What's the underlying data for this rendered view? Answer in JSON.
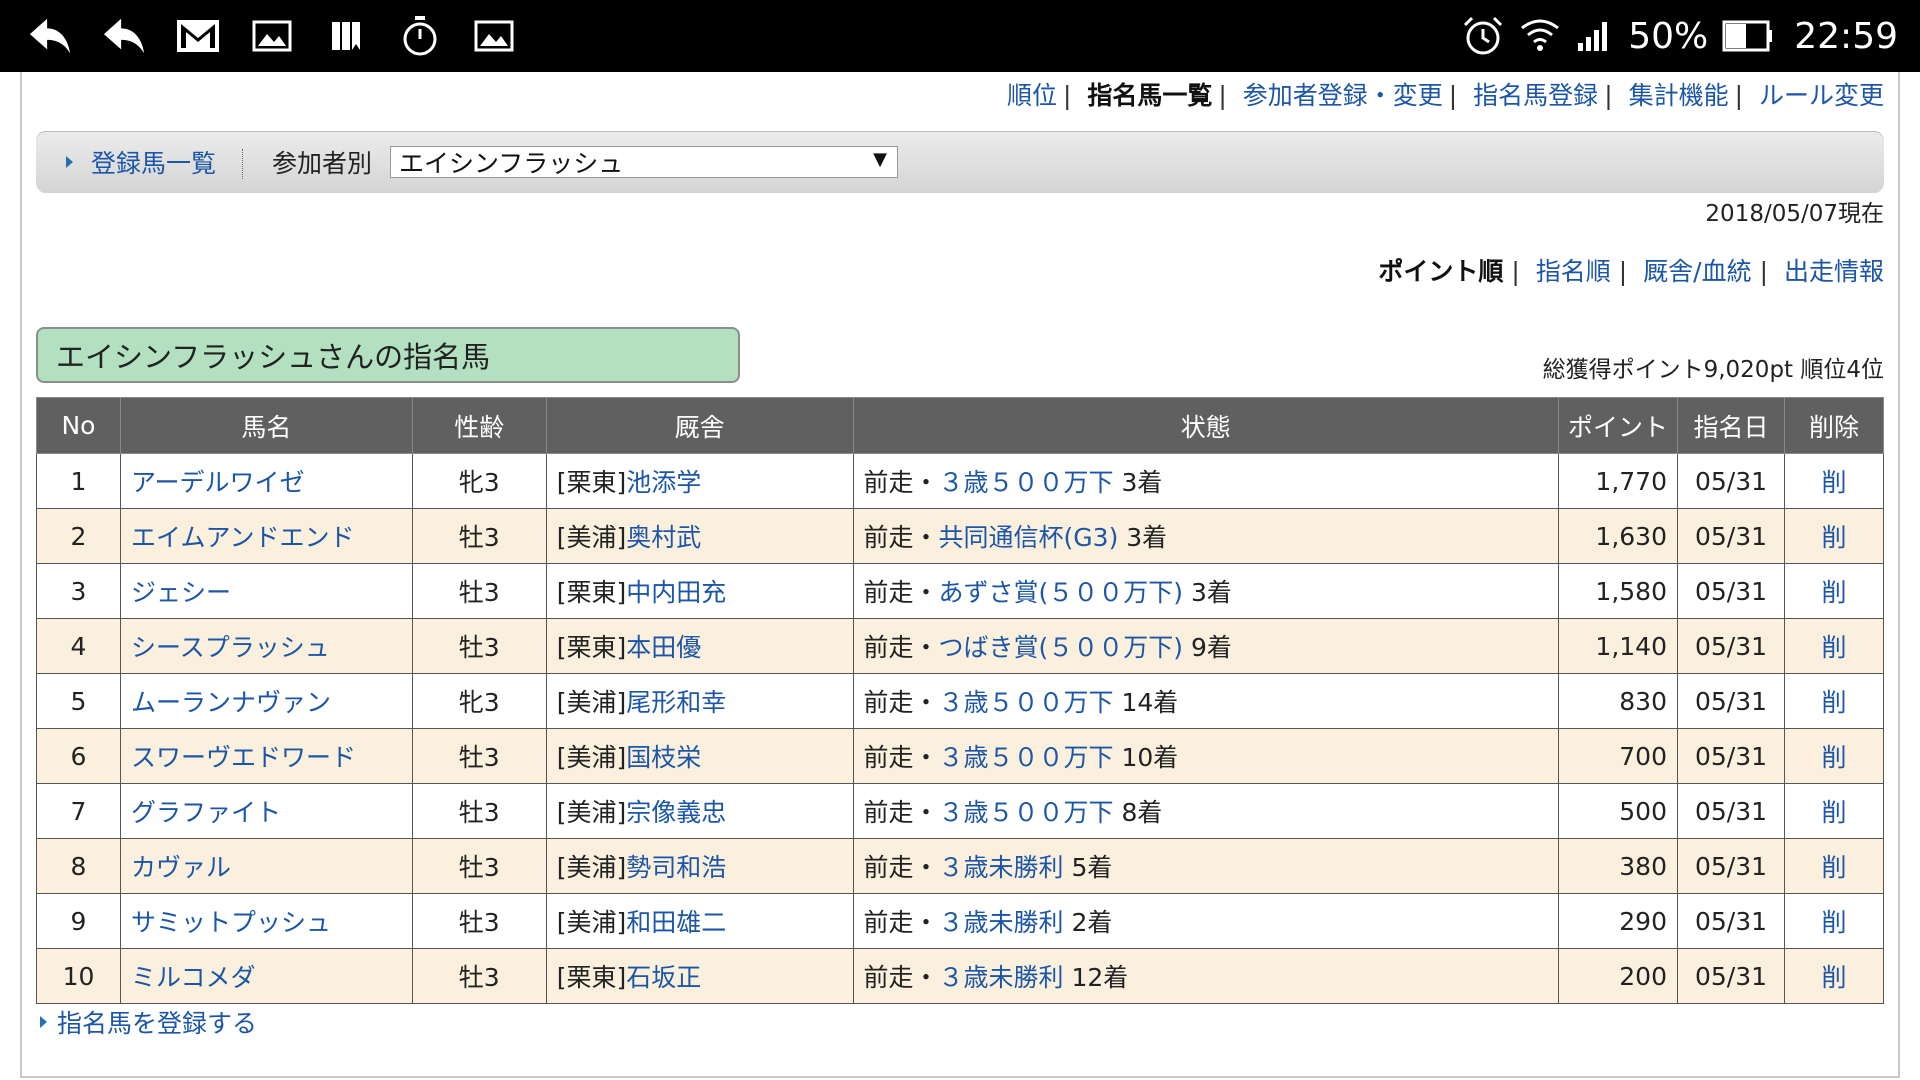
{
  "status_bar": {
    "left_icons": [
      "back-arrow-icon",
      "reply-icon",
      "gmail-icon",
      "image-icon",
      "bookmark-icon",
      "stopwatch-icon",
      "image-icon"
    ],
    "battery_percent": "50%",
    "time": "22:59"
  },
  "top_nav": {
    "items": [
      {
        "label": "順位",
        "current": false
      },
      {
        "label": "指名馬一覧",
        "current": true
      },
      {
        "label": "参加者登録・変更",
        "current": false
      },
      {
        "label": "指名馬登録",
        "current": false
      },
      {
        "label": "集計機能",
        "current": false
      },
      {
        "label": "ルール変更",
        "current": false
      }
    ]
  },
  "toolbar": {
    "registered_link": "登録馬一覧",
    "by_participant_label": "参加者別",
    "participant_selected": "エイシンフラッシュ"
  },
  "as_of": "2018/05/07現在",
  "sort_nav": {
    "items": [
      {
        "label": "ポイント順",
        "current": true
      },
      {
        "label": "指名順",
        "current": false
      },
      {
        "label": "厩舎/血統",
        "current": false
      },
      {
        "label": "出走情報",
        "current": false
      }
    ]
  },
  "section_title": "エイシンフラッシュさんの指名馬",
  "summary": "総獲得ポイント9,020pt 順位4位",
  "table": {
    "headers": [
      "No",
      "馬名",
      "性齢",
      "厩舎",
      "状態",
      "ポイント",
      "指名日",
      "削除"
    ],
    "rows": [
      {
        "no": "1",
        "name": "アーデルワイゼ",
        "sex_age": "牝3",
        "stable_prefix": "[栗東]",
        "trainer": "池添学",
        "status_prefix": "前走・",
        "race": "３歳５００万下",
        "finish": "3着",
        "points": "1,770",
        "date": "05/31",
        "del": "削"
      },
      {
        "no": "2",
        "name": "エイムアンドエンド",
        "sex_age": "牡3",
        "stable_prefix": "[美浦]",
        "trainer": "奥村武",
        "status_prefix": "前走・",
        "race": "共同通信杯(G3)",
        "finish": "3着",
        "points": "1,630",
        "date": "05/31",
        "del": "削"
      },
      {
        "no": "3",
        "name": "ジェシー",
        "sex_age": "牡3",
        "stable_prefix": "[栗東]",
        "trainer": "中内田充",
        "status_prefix": "前走・",
        "race": "あずさ賞(５００万下)",
        "finish": "3着",
        "points": "1,580",
        "date": "05/31",
        "del": "削"
      },
      {
        "no": "4",
        "name": "シースプラッシュ",
        "sex_age": "牡3",
        "stable_prefix": "[栗東]",
        "trainer": "本田優",
        "status_prefix": "前走・",
        "race": "つばき賞(５００万下)",
        "finish": "9着",
        "points": "1,140",
        "date": "05/31",
        "del": "削"
      },
      {
        "no": "5",
        "name": "ムーランナヴァン",
        "sex_age": "牝3",
        "stable_prefix": "[美浦]",
        "trainer": "尾形和幸",
        "status_prefix": "前走・",
        "race": "３歳５００万下",
        "finish": "14着",
        "points": "830",
        "date": "05/31",
        "del": "削"
      },
      {
        "no": "6",
        "name": "スワーヴエドワード",
        "sex_age": "牡3",
        "stable_prefix": "[美浦]",
        "trainer": "国枝栄",
        "status_prefix": "前走・",
        "race": "３歳５００万下",
        "finish": "10着",
        "points": "700",
        "date": "05/31",
        "del": "削"
      },
      {
        "no": "7",
        "name": "グラファイト",
        "sex_age": "牡3",
        "stable_prefix": "[美浦]",
        "trainer": "宗像義忠",
        "status_prefix": "前走・",
        "race": "３歳５００万下",
        "finish": "8着",
        "points": "500",
        "date": "05/31",
        "del": "削"
      },
      {
        "no": "8",
        "name": "カヴァル",
        "sex_age": "牡3",
        "stable_prefix": "[美浦]",
        "trainer": "勢司和浩",
        "status_prefix": "前走・",
        "race": "３歳未勝利",
        "finish": "5着",
        "points": "380",
        "date": "05/31",
        "del": "削"
      },
      {
        "no": "9",
        "name": "サミットプッシュ",
        "sex_age": "牡3",
        "stable_prefix": "[美浦]",
        "trainer": "和田雄二",
        "status_prefix": "前走・",
        "race": "３歳未勝利",
        "finish": "2着",
        "points": "290",
        "date": "05/31",
        "del": "削"
      },
      {
        "no": "10",
        "name": "ミルコメダ",
        "sex_age": "牡3",
        "stable_prefix": "[栗東]",
        "trainer": "石坂正",
        "status_prefix": "前走・",
        "race": "３歳未勝利",
        "finish": "12着",
        "points": "200",
        "date": "05/31",
        "del": "削"
      }
    ]
  },
  "register_link": "指名馬を登録する",
  "colors": {
    "link": "#1c56a8",
    "header_bg": "#606060",
    "alt_row": "#fbf0dd",
    "title_box": "#b3e0c0"
  }
}
